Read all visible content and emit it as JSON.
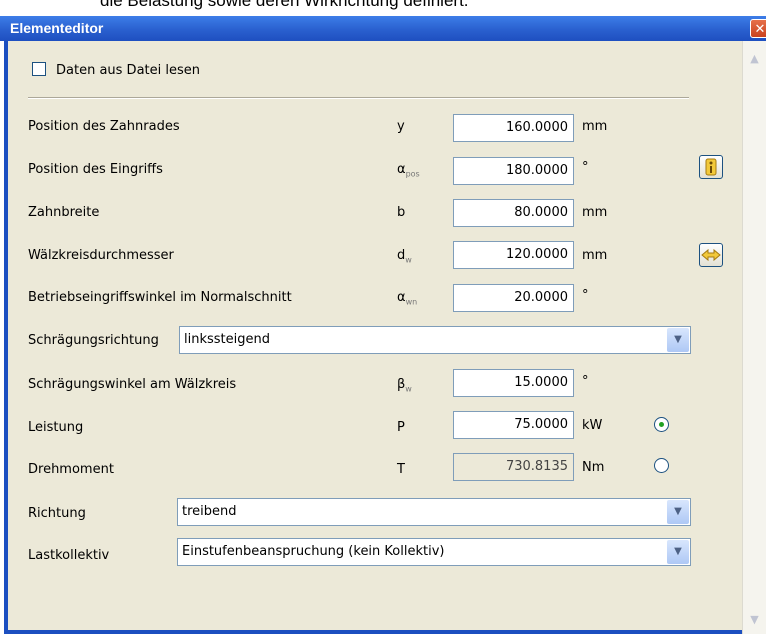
{
  "background_text": "die Belastung sowie deren Wirkrichtung definiert.",
  "window": {
    "title": "Elementeditor",
    "close_glyph": "✕"
  },
  "checkbox": {
    "label": "Daten aus Datei lesen",
    "checked": false
  },
  "rows": [
    {
      "label": "Position des Zahnrades",
      "symbol": "y",
      "symbol_sub": "",
      "value": "160.0000",
      "unit": "mm"
    },
    {
      "label": "Position des Eingriffs",
      "symbol": "α",
      "symbol_sub": "pos",
      "value": "180.0000",
      "unit": "°"
    },
    {
      "label": "Zahnbreite",
      "symbol": "b",
      "symbol_sub": "",
      "value": "80.0000",
      "unit": "mm"
    },
    {
      "label": "Wälzkreisdurchmesser",
      "symbol": "d",
      "symbol_sub": "w",
      "value": "120.0000",
      "unit": "mm"
    },
    {
      "label": "Betriebseingriffswinkel im Normalschnitt",
      "symbol": "α",
      "symbol_sub": "wn",
      "value": "20.0000",
      "unit": "°"
    }
  ],
  "helix_direction": {
    "label": "Schrägungsrichtung",
    "value": "linkssteigend"
  },
  "helix_angle": {
    "label": "Schrägungswinkel am Wälzkreis",
    "symbol": "β",
    "symbol_sub": "w",
    "value": "15.0000",
    "unit": "°"
  },
  "power": {
    "label": "Leistung",
    "symbol": "P",
    "value": "75.0000",
    "unit": "kW",
    "selected": true
  },
  "torque": {
    "label": "Drehmoment",
    "symbol": "T",
    "value": "730.8135",
    "unit": "Nm",
    "selected": false
  },
  "direction": {
    "label": "Richtung",
    "value": "treibend"
  },
  "load_spectrum": {
    "label": "Lastkollektiv",
    "value": "Einstufenbeanspruchung (kein Kollektiv)"
  },
  "icons": {
    "info": "info-icon",
    "swap": "swap-arrows-icon",
    "dropdown": "chevron-down-icon"
  }
}
